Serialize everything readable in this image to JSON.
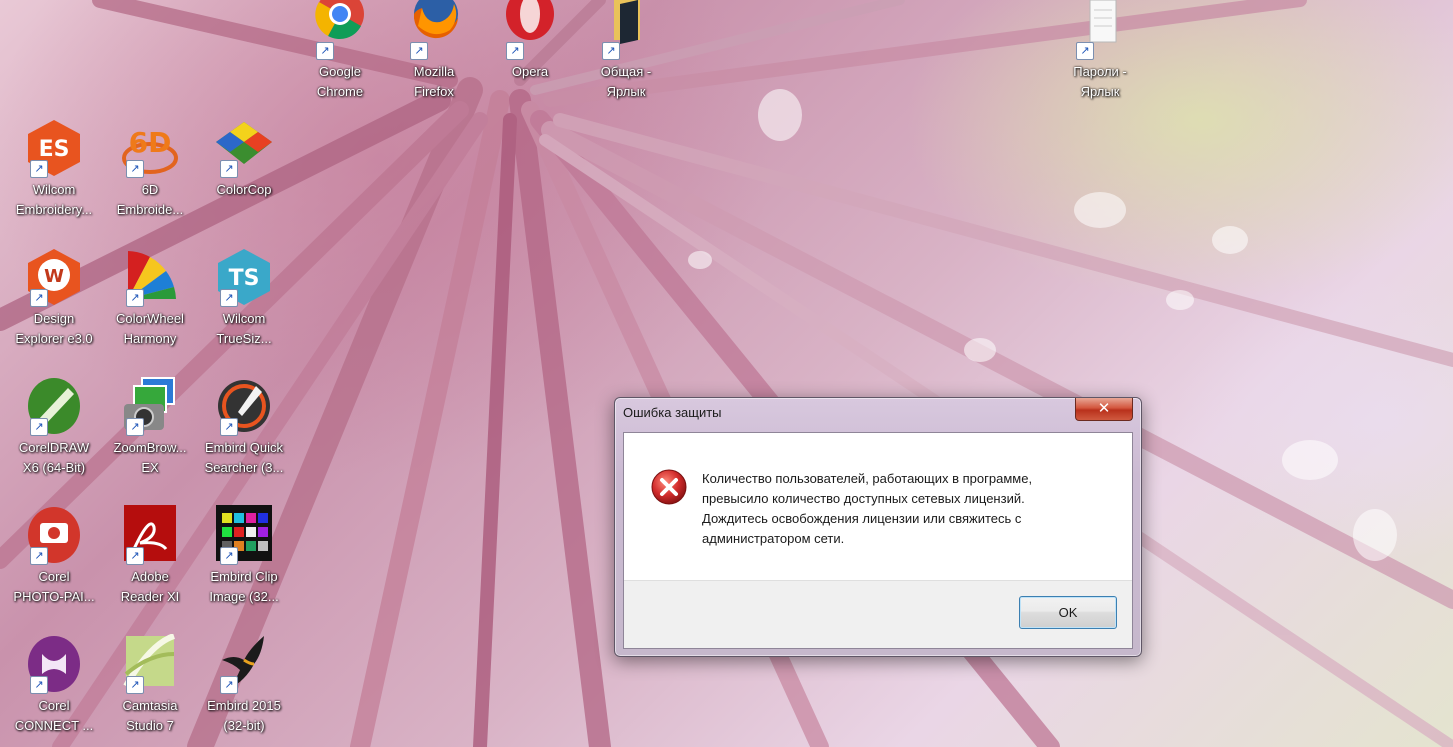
{
  "desktop": {
    "icons": [
      {
        "id": "google-chrome",
        "label": "Google\nChrome",
        "icon": "chrome-icon"
      },
      {
        "id": "mozilla-firefox",
        "label": "Mozilla\nFirefox",
        "icon": "firefox-icon"
      },
      {
        "id": "opera",
        "label": "Opera",
        "icon": "opera-icon"
      },
      {
        "id": "obshchaya",
        "label": "Общая -\nЯрлык",
        "icon": "folder-icon"
      },
      {
        "id": "paroli",
        "label": "Пароли -\nЯрлык",
        "icon": "document-icon"
      },
      {
        "id": "wilcom-es",
        "label": "Wilcom\nEmbroidery...",
        "icon": "wilcom-es-icon"
      },
      {
        "id": "6d-embroidery",
        "label": "6D\nEmbroide...",
        "icon": "6d-icon"
      },
      {
        "id": "colorcop",
        "label": "ColorCop",
        "icon": "colorcop-icon"
      },
      {
        "id": "design-explorer",
        "label": "Design\nExplorer e3.0",
        "icon": "design-explorer-icon"
      },
      {
        "id": "colorwheel",
        "label": "ColorWheel\nHarmony",
        "icon": "colorwheel-icon"
      },
      {
        "id": "wilcom-truesizer",
        "label": "Wilcom\nTrueSiz...",
        "icon": "truesizer-icon"
      },
      {
        "id": "coreldraw",
        "label": "CorelDRAW\nX6 (64-Bit)",
        "icon": "coreldraw-icon"
      },
      {
        "id": "zoombrowser",
        "label": "ZoomBrow...\nEX",
        "icon": "zoombrowser-icon"
      },
      {
        "id": "embird-quick",
        "label": "Embird Quick\nSearcher (3...",
        "icon": "embird-quick-icon"
      },
      {
        "id": "corel-photopaint",
        "label": "Corel\nPHOTO-PAI...",
        "icon": "photopaint-icon"
      },
      {
        "id": "adobe-reader",
        "label": "Adobe\nReader XI",
        "icon": "adobe-reader-icon"
      },
      {
        "id": "embird-clip",
        "label": "Embird Clip\nImage (32...",
        "icon": "embird-clip-icon"
      },
      {
        "id": "corel-connect",
        "label": "Corel\nCONNECT ...",
        "icon": "corel-connect-icon"
      },
      {
        "id": "camtasia",
        "label": "Camtasia\nStudio 7",
        "icon": "camtasia-icon"
      },
      {
        "id": "embird-2015",
        "label": "Embird 2015\n(32-bit)",
        "icon": "embird-icon"
      }
    ],
    "shortcut_arrow": "↗"
  },
  "dialog": {
    "title": "Ошибка защиты",
    "close_label": "✕",
    "icon": "error-icon",
    "message": "Количество пользователей, работающих в программе,\nпревысило количество доступных сетевых лицензий.\nДождитесь освобождения лицензии или свяжитесь с\nадминистратором сети.",
    "ok_label": "OK"
  },
  "colors": {
    "error_red": "#d12b2b",
    "ok_border": "#3c7fb1",
    "close_red": "#c8452c"
  }
}
